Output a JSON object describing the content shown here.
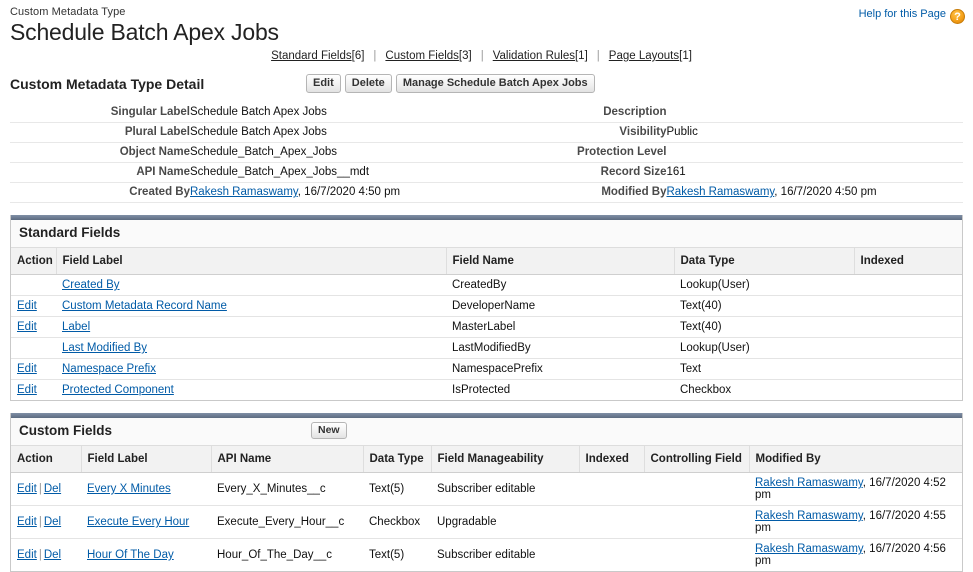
{
  "header": {
    "breadcrumb": "Custom Metadata Type",
    "title": "Schedule Batch Apex Jobs",
    "help_label": "Help for this Page",
    "help_icon_glyph": "?"
  },
  "section_links": [
    {
      "label": "Standard Fields",
      "count": "[6]"
    },
    {
      "label": "Custom Fields",
      "count": "[3]"
    },
    {
      "label": "Validation Rules",
      "count": "[1]"
    },
    {
      "label": "Page Layouts",
      "count": "[1]"
    }
  ],
  "separator": "|",
  "detail": {
    "title": "Custom Metadata Type Detail",
    "buttons": [
      {
        "label": "Edit"
      },
      {
        "label": "Delete"
      },
      {
        "label": "Manage Schedule Batch Apex Jobs"
      }
    ],
    "rows": [
      {
        "left_label": "Singular Label",
        "left_value": "Schedule Batch Apex Jobs",
        "right_label": "Description",
        "right_value": ""
      },
      {
        "left_label": "Plural Label",
        "left_value": "Schedule Batch Apex Jobs",
        "right_label": "Visibility",
        "right_value": "Public"
      },
      {
        "left_label": "Object Name",
        "left_value": "Schedule_Batch_Apex_Jobs",
        "right_label": "Protection Level",
        "right_value": ""
      },
      {
        "left_label": "API Name",
        "left_value": "Schedule_Batch_Apex_Jobs__mdt",
        "right_label": "Record Size",
        "right_value": "161"
      }
    ],
    "created_by": {
      "label": "Created By",
      "user": "Rakesh Ramaswamy",
      "timestamp": ", 16/7/2020 4:50 pm"
    },
    "modified_by": {
      "label": "Modified By",
      "user": "Rakesh Ramaswamy",
      "timestamp": ", 16/7/2020 4:50 pm"
    }
  },
  "standard_fields": {
    "title": "Standard Fields",
    "columns": [
      "Action",
      "Field Label",
      "Field Name",
      "Data Type",
      "Indexed"
    ],
    "rows": [
      {
        "action": "",
        "field_label": "Created By",
        "field_name": "CreatedBy",
        "data_type": "Lookup(User)",
        "indexed": ""
      },
      {
        "action": "Edit",
        "field_label": "Custom Metadata Record Name",
        "field_name": "DeveloperName",
        "data_type": "Text(40)",
        "indexed": ""
      },
      {
        "action": "Edit",
        "field_label": "Label",
        "field_name": "MasterLabel",
        "data_type": "Text(40)",
        "indexed": ""
      },
      {
        "action": "",
        "field_label": "Last Modified By",
        "field_name": "LastModifiedBy",
        "data_type": "Lookup(User)",
        "indexed": ""
      },
      {
        "action": "Edit",
        "field_label": "Namespace Prefix",
        "field_name": "NamespacePrefix",
        "data_type": "Text",
        "indexed": ""
      },
      {
        "action": "Edit",
        "field_label": "Protected Component",
        "field_name": "IsProtected",
        "data_type": "Checkbox",
        "indexed": ""
      }
    ]
  },
  "custom_fields": {
    "title": "Custom Fields",
    "new_button": "New",
    "columns": [
      "Action",
      "Field Label",
      "API Name",
      "Data Type",
      "Field Manageability",
      "Indexed",
      "Controlling Field",
      "Modified By"
    ],
    "action_edit": "Edit",
    "action_del": "Del",
    "action_sep": "|",
    "rows": [
      {
        "field_label": "Every X Minutes",
        "api_name": "Every_X_Minutes__c",
        "data_type": "Text(5)",
        "manageability": "Subscriber editable",
        "indexed": "",
        "controlling_field": "",
        "modified_user": "Rakesh Ramaswamy",
        "modified_time": ", 16/7/2020 4:52 pm"
      },
      {
        "field_label": "Execute Every Hour",
        "api_name": "Execute_Every_Hour__c",
        "data_type": "Checkbox",
        "manageability": "Upgradable",
        "indexed": "",
        "controlling_field": "",
        "modified_user": "Rakesh Ramaswamy",
        "modified_time": ", 16/7/2020 4:55 pm"
      },
      {
        "field_label": "Hour Of The Day",
        "api_name": "Hour_Of_The_Day__c",
        "data_type": "Text(5)",
        "manageability": "Subscriber editable",
        "indexed": "",
        "controlling_field": "",
        "modified_user": "Rakesh Ramaswamy",
        "modified_time": ", 16/7/2020 4:56 pm"
      }
    ]
  },
  "colors": {
    "link": "#015ba7",
    "panel_bar": "#5c6b80",
    "help_icon": "#f5a21a"
  }
}
